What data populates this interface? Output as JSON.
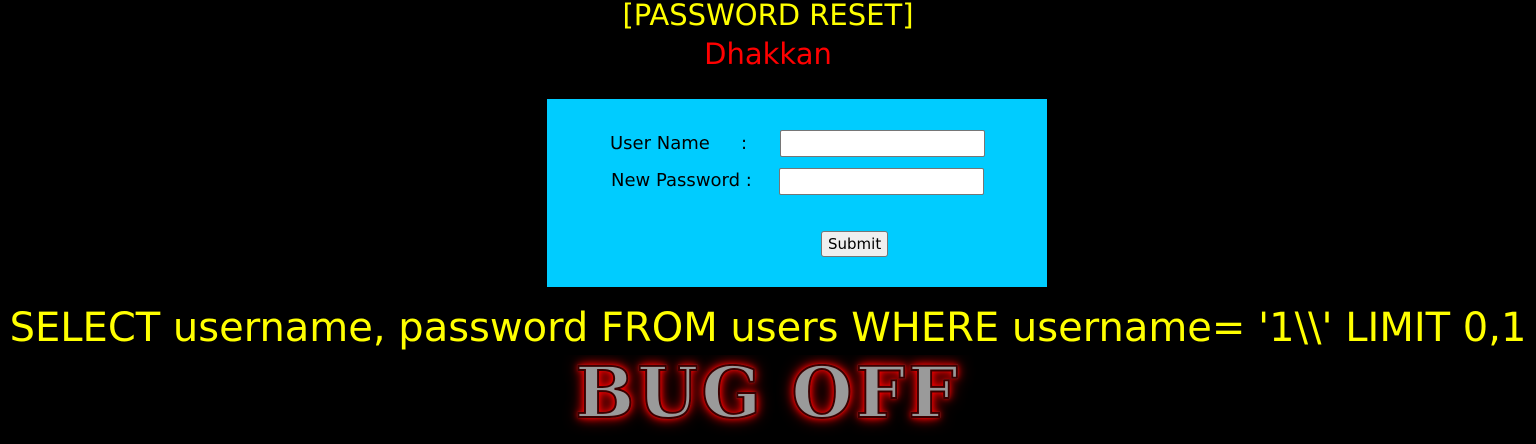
{
  "header": {
    "title": "[PASSWORD RESET]",
    "subtitle": "Dhakkan"
  },
  "form": {
    "username_label": "User Name",
    "username_colon": ":",
    "password_label": "New Password :",
    "username_value": "",
    "password_value": "",
    "submit_label": "Submit"
  },
  "query": {
    "sql": "SELECT username, password FROM users WHERE username= '1\\\\' LIMIT 0,1"
  },
  "logo": {
    "text": "BUG OFF",
    "text_line2": "",
    "glow_color": "#FF0000"
  },
  "colors": {
    "background": "#000000",
    "title": "#FFFF00",
    "subtitle": "#FF0000",
    "panel": "#00CCFF",
    "sql": "#FFFF00"
  }
}
